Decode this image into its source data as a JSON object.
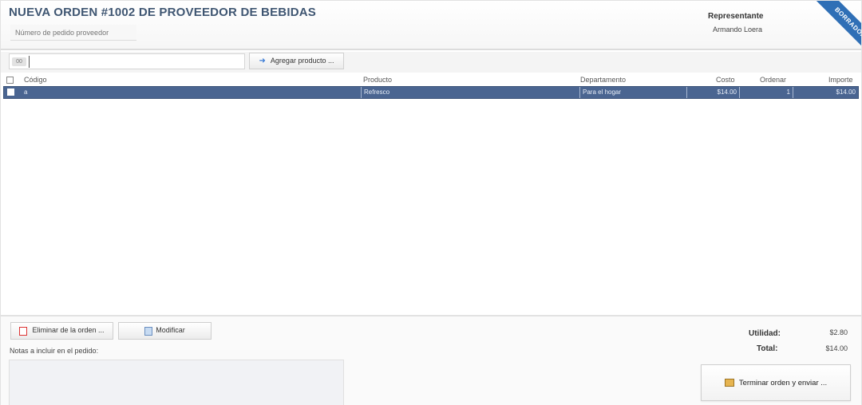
{
  "header": {
    "title": "NUEVA ORDEN #1002 DE PROVEEDOR DE BEBIDAS",
    "order_number_placeholder": "Número de pedido proveedor",
    "representative_label": "Representante",
    "representative_name": "Armando Loera",
    "status_ribbon": "BORRADOR",
    "ribbon_color": "#2f6fb6"
  },
  "toolbar": {
    "scan_badge": "00",
    "scan_value": "",
    "add_product_label": "Agregar producto ..."
  },
  "table": {
    "columns": [
      "Código",
      "Producto",
      "Departamento",
      "Costo",
      "Ordenar",
      "Importe"
    ],
    "rows": [
      {
        "code": "a",
        "product": "Refresco",
        "department": "Para el hogar",
        "cost": "$14.00",
        "order": "1",
        "amount": "$14.00",
        "selected": true
      }
    ],
    "selected_row_color": "#4a6591"
  },
  "footer": {
    "delete_label": "Eliminar de la orden ...",
    "modify_label": "Modificar",
    "notes_label": "Notas a incluir en el pedido:",
    "notes_value": "",
    "utility_label": "Utilidad:",
    "utility_value": "$2.80",
    "total_label": "Total:",
    "total_value": "$14.00",
    "finish_label": "Terminar orden y enviar ..."
  }
}
